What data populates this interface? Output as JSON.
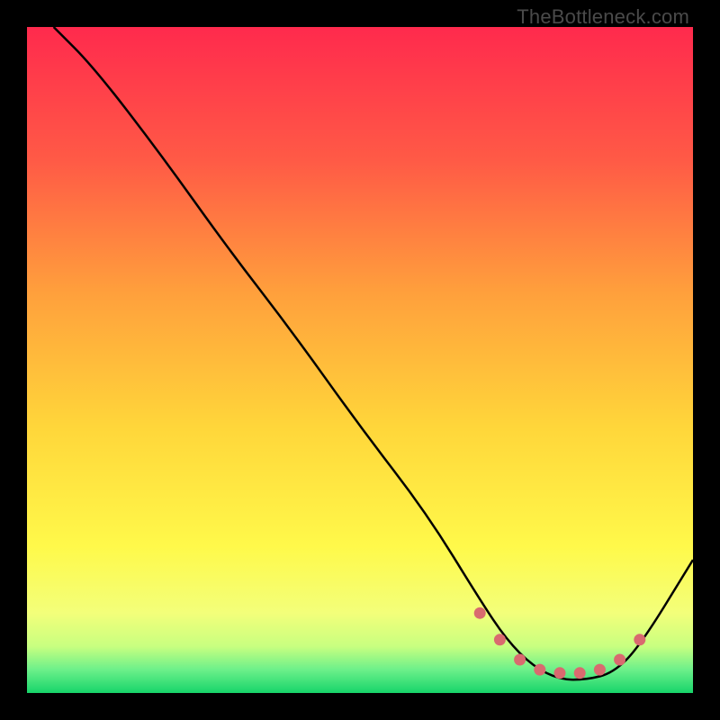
{
  "watermark": "TheBottleneck.com",
  "chart_data": {
    "type": "line",
    "title": "",
    "xlabel": "",
    "ylabel": "",
    "xlim": [
      0,
      100
    ],
    "ylim": [
      0,
      100
    ],
    "grid": false,
    "legend": false,
    "series": [
      {
        "name": "bottleneck-curve",
        "color": "#000000",
        "x": [
          4,
          10,
          20,
          30,
          40,
          50,
          60,
          68,
          72,
          76,
          80,
          84,
          88,
          92,
          100
        ],
        "y": [
          100,
          94,
          81,
          67,
          54,
          40,
          27,
          14,
          8,
          4,
          2,
          2,
          3,
          7,
          20
        ]
      },
      {
        "name": "optimal-band-markers",
        "color": "#d96a6f",
        "type": "scatter",
        "x": [
          68,
          71,
          74,
          77,
          80,
          83,
          86,
          89,
          92
        ],
        "y": [
          12,
          8,
          5,
          3.5,
          3,
          3,
          3.5,
          5,
          8
        ]
      }
    ],
    "gradient_stops": [
      {
        "offset": 0.0,
        "color": "#ff2a4d"
      },
      {
        "offset": 0.2,
        "color": "#ff5a46"
      },
      {
        "offset": 0.4,
        "color": "#ffa03c"
      },
      {
        "offset": 0.6,
        "color": "#ffd63a"
      },
      {
        "offset": 0.78,
        "color": "#fff94a"
      },
      {
        "offset": 0.88,
        "color": "#f3ff7a"
      },
      {
        "offset": 0.93,
        "color": "#c8ff80"
      },
      {
        "offset": 0.965,
        "color": "#6cf08a"
      },
      {
        "offset": 1.0,
        "color": "#17d46a"
      }
    ]
  }
}
